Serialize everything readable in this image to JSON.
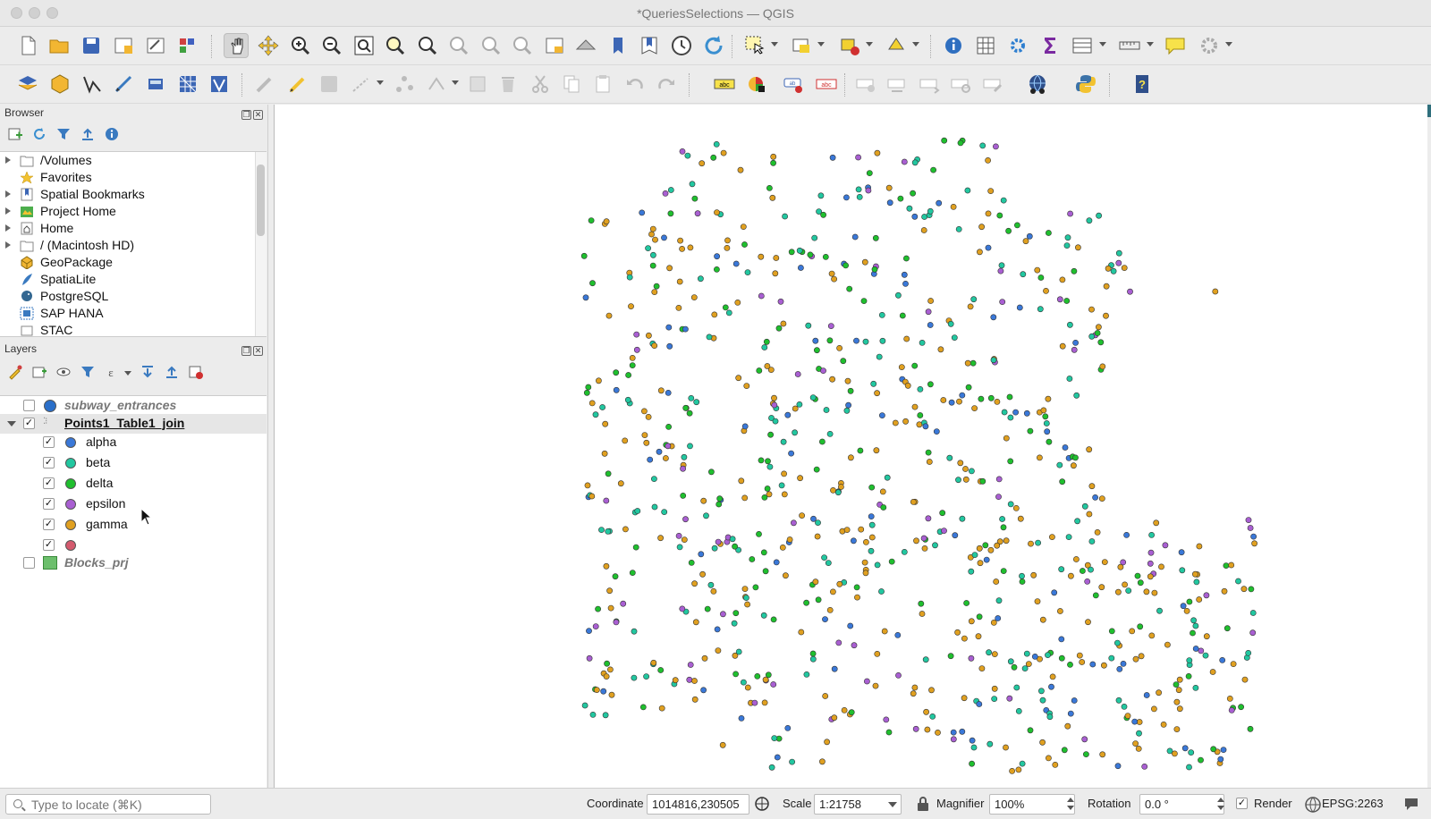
{
  "window": {
    "title": "*QueriesSelections — QGIS"
  },
  "toolbar1": {
    "tools": [
      "new-project-icon",
      "open-project-icon",
      "save-project-icon",
      "new-print-layout-icon",
      "layout-manager-icon",
      "style-manager-icon",
      "pan-icon",
      "pan-to-selection-icon",
      "zoom-in-icon",
      "zoom-out-icon",
      "zoom-full-icon",
      "zoom-to-selection-icon",
      "zoom-to-layer-icon",
      "zoom-native-icon",
      "zoom-last-icon",
      "zoom-next-icon",
      "new-map-view-icon",
      "new-3d-view-icon",
      "new-bookmark-icon",
      "show-bookmarks-icon",
      "temporal-controller-icon",
      "refresh-icon",
      "select-features-icon",
      "select-by-value-icon",
      "deselect-icon",
      "select-by-location-icon",
      "identify-icon",
      "open-attribute-table-icon",
      "processing-toolbox-icon",
      "statistical-summary-icon",
      "attribute-table-icon",
      "measure-icon",
      "map-tips-icon",
      "plugins-settings-icon"
    ]
  },
  "toolbar2": {
    "tools": [
      "data-source-manager-icon",
      "new-geopackage-layer-icon",
      "digitize-icon",
      "new-shapefile-icon",
      "new-virtual-layer-icon",
      "new-mesh-icon",
      "virtual-layer-icon",
      "current-edits-icon",
      "toggle-editing-icon",
      "save-edits-icon",
      "digitize-line-icon",
      "vertex-tool-icon",
      "move-feature-icon",
      "modify-attributes-icon",
      "delete-selected-icon",
      "cut-features-icon",
      "copy-features-icon",
      "paste-features-icon",
      "undo-icon",
      "redo-icon",
      "label-toolbar-icon",
      "diagram-icon",
      "pin-label-icon",
      "highlight-label-icon",
      "show-hide-labels-icon",
      "move-label-icon",
      "rotate-label-icon",
      "change-label-icon",
      "label-properties-icon",
      "globe-icon",
      "python-console-icon",
      "help-icon"
    ]
  },
  "browser": {
    "title": "Browser",
    "items": [
      {
        "label": "/Volumes",
        "icon": "folder-icon",
        "expandable": true
      },
      {
        "label": "Favorites",
        "icon": "star-icon",
        "expandable": false
      },
      {
        "label": "Spatial Bookmarks",
        "icon": "bookmark-icon",
        "expandable": true
      },
      {
        "label": "Project Home",
        "icon": "project-home-icon",
        "expandable": true
      },
      {
        "label": "Home",
        "icon": "home-icon",
        "expandable": true
      },
      {
        "label": "/ (Macintosh HD)",
        "icon": "folder-icon",
        "expandable": true
      },
      {
        "label": "GeoPackage",
        "icon": "geopackage-icon",
        "expandable": false
      },
      {
        "label": "SpatiaLite",
        "icon": "spatialite-icon",
        "expandable": false
      },
      {
        "label": "PostgreSQL",
        "icon": "postgresql-icon",
        "expandable": false
      },
      {
        "label": "SAP HANA",
        "icon": "sap-hana-icon",
        "expandable": false
      },
      {
        "label": "STAC",
        "icon": "stac-icon",
        "expandable": false
      }
    ]
  },
  "layers": {
    "title": "Layers",
    "items": [
      {
        "label": "subway_entrances",
        "checked": false,
        "color": "#2a6fc9",
        "kind": "point-layer"
      },
      {
        "label": "Points1_Table1_join",
        "checked": true,
        "kind": "categorized-layer"
      },
      {
        "label": "alpha",
        "checked": true,
        "color": "#3a78d8"
      },
      {
        "label": "beta",
        "checked": true,
        "color": "#22c7a0"
      },
      {
        "label": "delta",
        "checked": true,
        "color": "#1fbf2e"
      },
      {
        "label": "epsilon",
        "checked": true,
        "color": "#a95fd2"
      },
      {
        "label": "gamma",
        "checked": true,
        "color": "#e0a020"
      },
      {
        "label": "",
        "checked": true,
        "color": "#d45a6e"
      },
      {
        "label": "Blocks_prj",
        "checked": false,
        "color": "#6cbf6c",
        "kind": "polygon-layer"
      }
    ]
  },
  "status": {
    "search_placeholder": "Type to locate (⌘K)",
    "coordinate_label": "Coordinate",
    "coordinate_value": "1014816,230505",
    "scale_label": "Scale",
    "scale_value": "1:21758",
    "magnifier_label": "Magnifier",
    "magnifier_value": "100%",
    "rotation_label": "Rotation",
    "rotation_value": "0.0 °",
    "render_label": "Render",
    "render_checked": true,
    "crs": "EPSG:2263"
  }
}
